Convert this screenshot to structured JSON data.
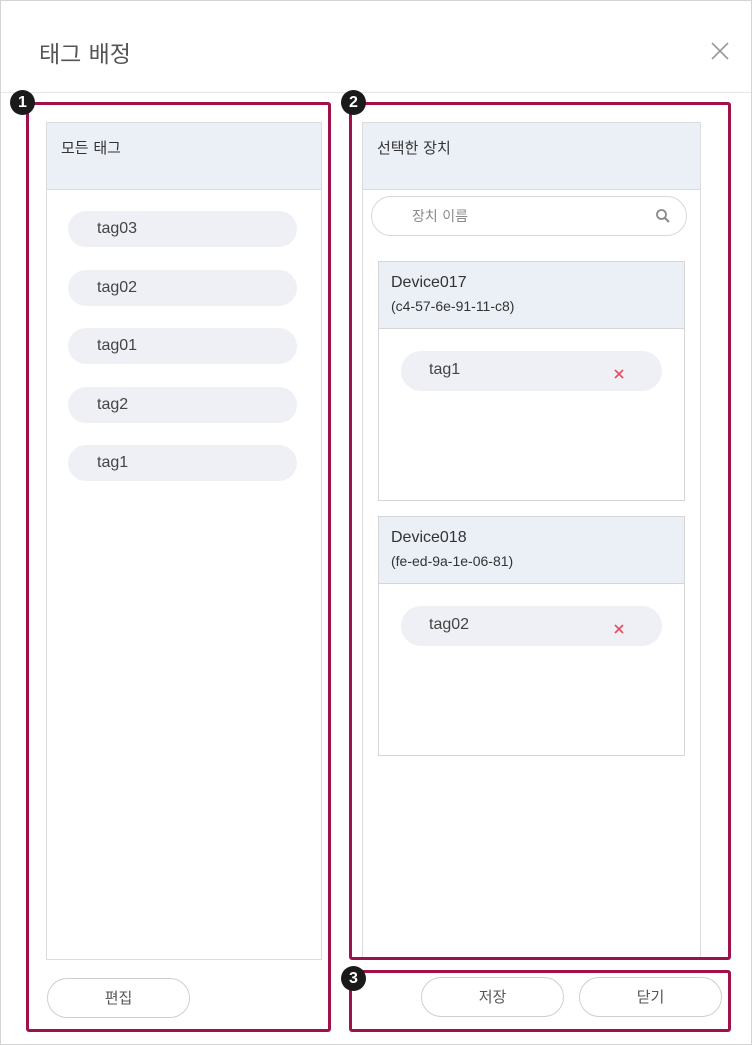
{
  "dialog": {
    "title": "태그 배정"
  },
  "all_tags": {
    "title": "모든 태그",
    "tags": [
      "tag03",
      "tag02",
      "tag01",
      "tag2",
      "tag1"
    ],
    "edit_button": "편집"
  },
  "selected_devices": {
    "title": "선택한 장치",
    "search_placeholder": "장치 이름",
    "devices": [
      {
        "name": "Device017",
        "mac": "(c4-57-6e-91-11-c8)",
        "tags": [
          "tag1"
        ]
      },
      {
        "name": "Device018",
        "mac": "(fe-ed-9a-1e-06-81)",
        "tags": [
          "tag02"
        ]
      }
    ]
  },
  "actions": {
    "save": "저장",
    "close": "닫기"
  },
  "annotations": [
    "1",
    "2",
    "3"
  ],
  "colors": {
    "highlight": "#a0114b",
    "header_bg": "#ebeff6",
    "pill_bg": "#eef0f6",
    "remove_x": "#e84a5f"
  }
}
